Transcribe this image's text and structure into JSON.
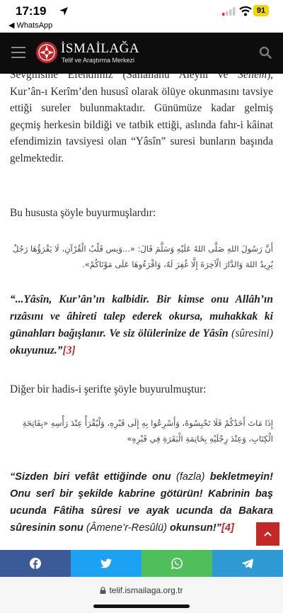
{
  "status": {
    "time": "17:19",
    "back_app": "◀ WhatsApp",
    "battery": "91"
  },
  "header": {
    "brand": "İSMAİLAĞA",
    "subtitle": "Telif ve Araştırma Merkezi",
    "icons": [
      "hamburger-icon",
      "logo-emblem",
      "search-icon"
    ]
  },
  "article": {
    "p1_clip": "Sevgilisine Efendimiz (Sallallâhu Aleyhi ve",
    "p1_italic": "Sellem",
    "p1_text": "), Kur’ân-ı Kerîm’den hususî olarak ölüye okunmasını tavsiye ettiği sureler bulunmaktadır. Günümüze kadar gelmiş geçmiş herkesin bildiği ve tatbik ettiği, aslında fahr-i kâinat efendimizin tavsiyesi olan “Yâsîn” suresi bunların başında gelmektedir.",
    "p2": "Bu hususta şöyle buyurmuşlardır:",
    "arabic1": "أَنَّ رَسُولَ اللهِ صَلَّى اللهُ عَلَيْهِ وَسَلَّمَ قَالَ: «...وَيس قَلْبُ الْقُرْآنِ، لَا يَقْرَؤُهَا رَجُلٌ يُرِيدُ اللهَ وَالدَّارَ الْآخِرَةَ إِلَّا غُفِرَ لَهُ، وَاقْرَءُوهَا عَلَى مَوْتَاكُمْ».",
    "quote1_a": "“...Yâsîn, Kur’ân’ın kalbidir. Bir kimse onu Allâh’ın rızâsını ve âhireti talep ederek okursa, muhakkak ki günahları bağışlanır. Ve siz ölülerinize de Yâsîn ",
    "quote1_b": "(sûresini)",
    "quote1_c": " okuyunuz.”",
    "quote1_ref": "[3]",
    "p3": "Diğer bir hadis-i şerifte şöyle buyurulmuştur:",
    "arabic2": "إِذَا مَاتَ أَحَدُكُمْ فَلَا تَحْبِسُوهُ، وَأَسْرِعُوا بِهِ إِلَى قَبْرِهِ، وَلْيُقْرَأْ عِنْدَ رَأْسِهِ «بِفَاتِحَةِ الْكِتَابِ، وَعِنْدَ رِجْلَيْهِ بِخَاتِمَةِ الْبَقَرَةِ فِي قَبْرِهِ»",
    "quote2_a": "“Sizden biri vefât ettiğinde onu ",
    "quote2_b": "(fazla)",
    "quote2_c": " bekletmeyin! Onu serî bir şekilde kabrine götürün! Kabrinin baş ucunda Fâtiha sûresi ve ayak ucunda da Bakara sûresinin sonu ",
    "quote2_d": "(Âmene’r-Resûlü)",
    "quote2_e": " okunsun!”",
    "quote2_ref": "[4]"
  },
  "share": {
    "buttons": [
      "facebook-icon",
      "twitter-icon",
      "whatsapp-icon",
      "telegram-icon"
    ],
    "colors": [
      "#3b5b98",
      "#1da1f2",
      "#4fbf5c",
      "#2d9ad3"
    ]
  },
  "browser": {
    "url": "telif.ismailaga.org.tr"
  },
  "colors": {
    "accent": "#c0272d",
    "header_bg": "#0d0d0d"
  }
}
